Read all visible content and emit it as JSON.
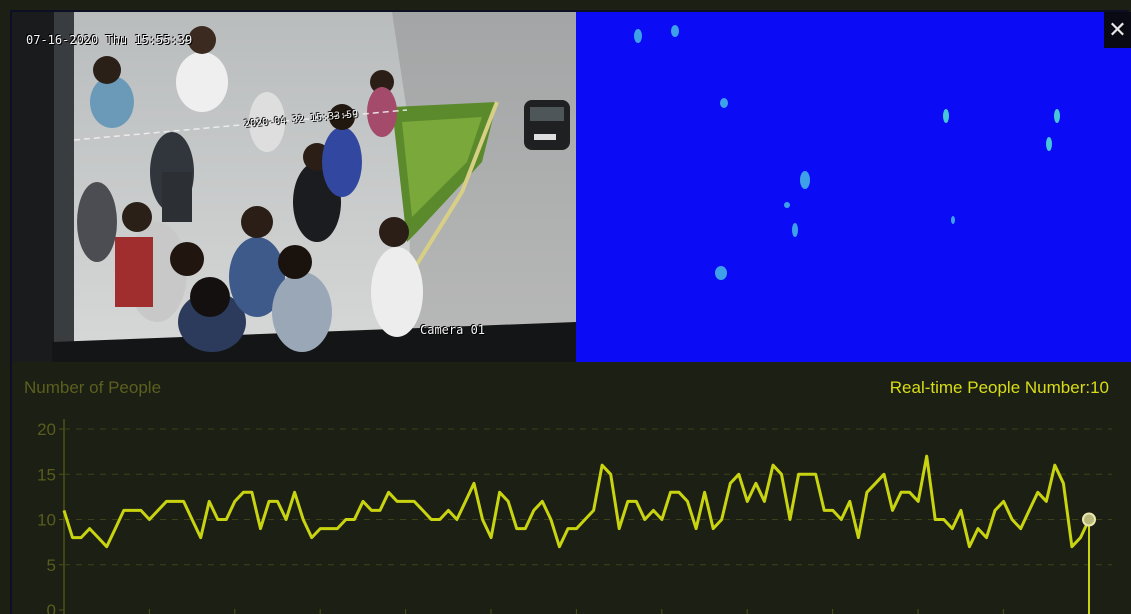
{
  "camera": {
    "timestamp": "07-16-2020 Thu 15:55:39",
    "overlay_text": "2020-04 32 15:33:59",
    "camera_name": "Camera 01"
  },
  "heatmap": {
    "background_color": "#0b0bf5",
    "close_icon": "close-icon",
    "close_glyph": "✕"
  },
  "panel": {
    "title": "Number of People",
    "realtime_label": "Real-time People Number:",
    "realtime_value": "10"
  },
  "chart_data": {
    "type": "line",
    "title": "Number of People",
    "xlabel": "",
    "ylabel": "",
    "ylim": [
      0,
      20
    ],
    "y_ticks": [
      "0",
      "5",
      "10",
      "15",
      "20"
    ],
    "grid": true,
    "line_color": "#c9d410",
    "series": [
      {
        "values": [
          11,
          8,
          8,
          9,
          8,
          7,
          9,
          11,
          11,
          11,
          10,
          11,
          12,
          12,
          12,
          10,
          8,
          12,
          10,
          10,
          12,
          13,
          13,
          9,
          12,
          12,
          10,
          13,
          10,
          8,
          9,
          9,
          9,
          10,
          10,
          12,
          11,
          11,
          13,
          12,
          12,
          12,
          11,
          10,
          10,
          11,
          10,
          12,
          14,
          10,
          8,
          13,
          12,
          9,
          9,
          11,
          12,
          10,
          7,
          9,
          9,
          10,
          11,
          16,
          15,
          9,
          12,
          12,
          10,
          11,
          10,
          13,
          13,
          12,
          9,
          13,
          9,
          10,
          14,
          15,
          12,
          14,
          12,
          16,
          15,
          10,
          15,
          15,
          15,
          11,
          11,
          10,
          12,
          8,
          13,
          14,
          15,
          11,
          13,
          13,
          12,
          17,
          10,
          10,
          9,
          11,
          7,
          9,
          8,
          11,
          12,
          10,
          9,
          11,
          13,
          12,
          16,
          14,
          7,
          8,
          10
        ]
      }
    ],
    "current_value": 10
  }
}
